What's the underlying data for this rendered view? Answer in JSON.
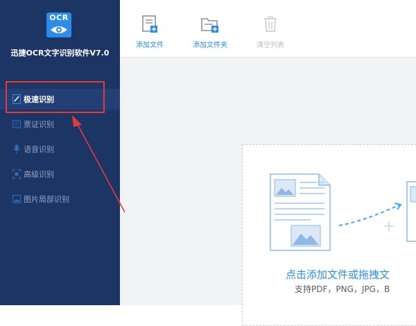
{
  "app": {
    "logo_text": "OCR",
    "title": "迅捷OCR文字识别软件V7.0"
  },
  "sidebar": {
    "items": [
      {
        "label": "极速识别",
        "icon": "fast-recognition-icon",
        "active": true
      },
      {
        "label": "票证识别",
        "icon": "ticket-icon",
        "active": false
      },
      {
        "label": "语音识别",
        "icon": "microphone-icon",
        "active": false
      },
      {
        "label": "高级识别",
        "icon": "advanced-icon",
        "active": false
      },
      {
        "label": "图片局部识别",
        "icon": "image-region-icon",
        "active": false
      }
    ]
  },
  "toolbar": {
    "add_file_label": "添加文件",
    "add_folder_label": "添加文件夹",
    "clear_list_label": "清空列表"
  },
  "dropzone": {
    "title": "点击添加文件或拖拽文",
    "subtitle": "支持PDF，PNG，JPG，B"
  },
  "colors": {
    "sidebar_bg": "#1c3564",
    "accent": "#2e8be6",
    "highlight": "#e23b3b"
  }
}
